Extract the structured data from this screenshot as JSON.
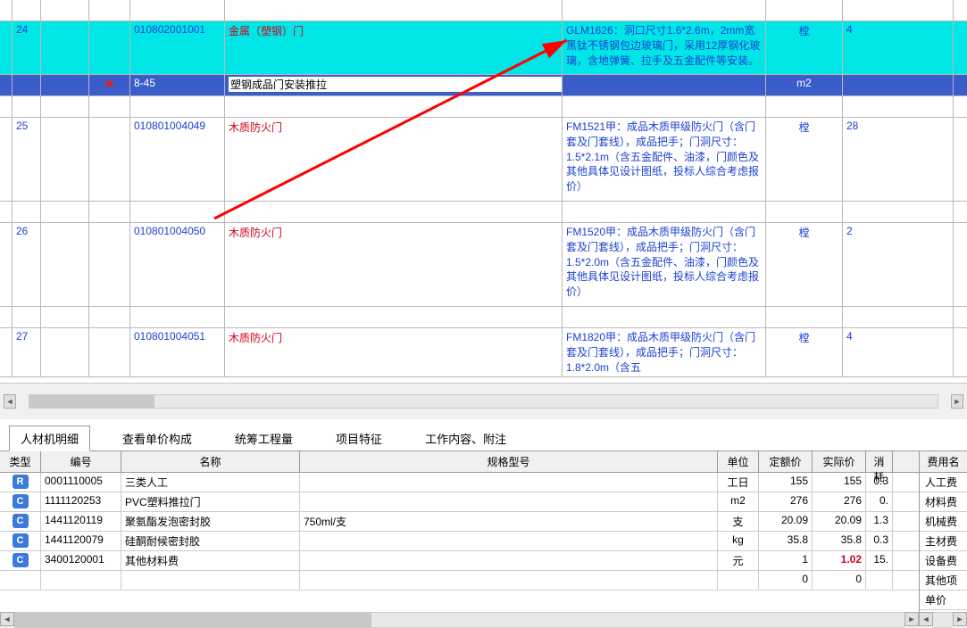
{
  "mainRows": [
    {
      "type": "blank"
    },
    {
      "type": "data",
      "cls": "cyan",
      "seq": "24",
      "code": "010802001001",
      "name": "金属（塑钢）门",
      "nameClass": "red-text",
      "desc": "GLM1626：洞口尺寸1.6*2.6m，2mm宽黑钛不锈钢包边玻璃门，采用12厚钢化玻璃，含地弹簧、拉手及五金配件等安装。",
      "unit": "樘",
      "qty": "4",
      "height": "tall"
    },
    {
      "type": "selected",
      "cls": "blue",
      "flag": true,
      "code": "8-45",
      "nameBox": "塑钢成品门安装推拉",
      "unit": "m2"
    },
    {
      "type": "blank"
    },
    {
      "type": "data",
      "seq": "25",
      "code": "010801004049",
      "name": "木质防火门",
      "nameClass": "red-text",
      "desc": "FM1521甲：成品木质甲级防火门（含门套及门套线），成品把手；门洞尺寸：1.5*2.1m（含五金配件、油漆，门颜色及其他具体见设计图纸，投标人综合考虑报价）",
      "unit": "樘",
      "qty": "28",
      "height": "tall2"
    },
    {
      "type": "blank"
    },
    {
      "type": "data",
      "seq": "26",
      "code": "010801004050",
      "name": "木质防火门",
      "nameClass": "red-text",
      "desc": "FM1520甲：成品木质甲级防火门（含门套及门套线），成品把手；门洞尺寸：1.5*2.0m（含五金配件、油漆，门颜色及其他具体见设计图纸，投标人综合考虑报价）",
      "unit": "樘",
      "qty": "2",
      "height": "tall2"
    },
    {
      "type": "blank"
    },
    {
      "type": "data",
      "seq": "27",
      "code": "010801004051",
      "name": "木质防火门",
      "nameClass": "red-text",
      "desc": "FM1820甲：成品木质甲级防火门（含门套及门套线），成品把手；门洞尺寸：1.8*2.0m（含五",
      "unit": "樘",
      "qty": "4",
      "height": ""
    }
  ],
  "tabs": [
    {
      "label": "人材机明细",
      "active": true
    },
    {
      "label": "查看单价构成",
      "active": false
    },
    {
      "label": "统筹工程量",
      "active": false
    },
    {
      "label": "项目特征",
      "active": false
    },
    {
      "label": "工作内容、附注",
      "active": false
    }
  ],
  "detailHeaders": {
    "type": "类型",
    "code": "编号",
    "name": "名称",
    "spec": "规格型号",
    "unit": "单位",
    "dprice": "定额价",
    "aprice": "实际价",
    "cons": "消耗"
  },
  "detailRows": [
    {
      "badge": "R",
      "code": "0001110005",
      "name": "三类人工",
      "spec": "",
      "unit": "工日",
      "dprice": "155",
      "aprice": "155",
      "cons": "0.3"
    },
    {
      "badge": "C",
      "code": "1111120253",
      "name": "PVC塑料推拉门",
      "spec": "",
      "unit": "m2",
      "dprice": "276",
      "aprice": "276",
      "cons": "0."
    },
    {
      "badge": "C",
      "code": "1441120119",
      "name": "聚氨酯发泡密封胶",
      "spec": "750ml/支",
      "unit": "支",
      "dprice": "20.09",
      "aprice": "20.09",
      "cons": "1.3"
    },
    {
      "badge": "C",
      "code": "1441120079",
      "name": "硅酮耐候密封胶",
      "spec": "",
      "unit": "kg",
      "dprice": "35.8",
      "aprice": "35.8",
      "cons": "0.3"
    },
    {
      "badge": "C",
      "code": "3400120001",
      "name": "其他材料费",
      "spec": "",
      "unit": "元",
      "dprice": "1",
      "aprice": "1.02",
      "apriceRed": true,
      "cons": "15."
    },
    {
      "badge": "",
      "code": "",
      "name": "",
      "spec": "",
      "unit": "",
      "dprice": "0",
      "aprice": "0",
      "cons": ""
    }
  ],
  "rightHeader": "费用名",
  "rightItems": [
    "人工费",
    "材料费",
    "机械费",
    "主材费",
    "设备费",
    "其他项",
    "单价"
  ]
}
